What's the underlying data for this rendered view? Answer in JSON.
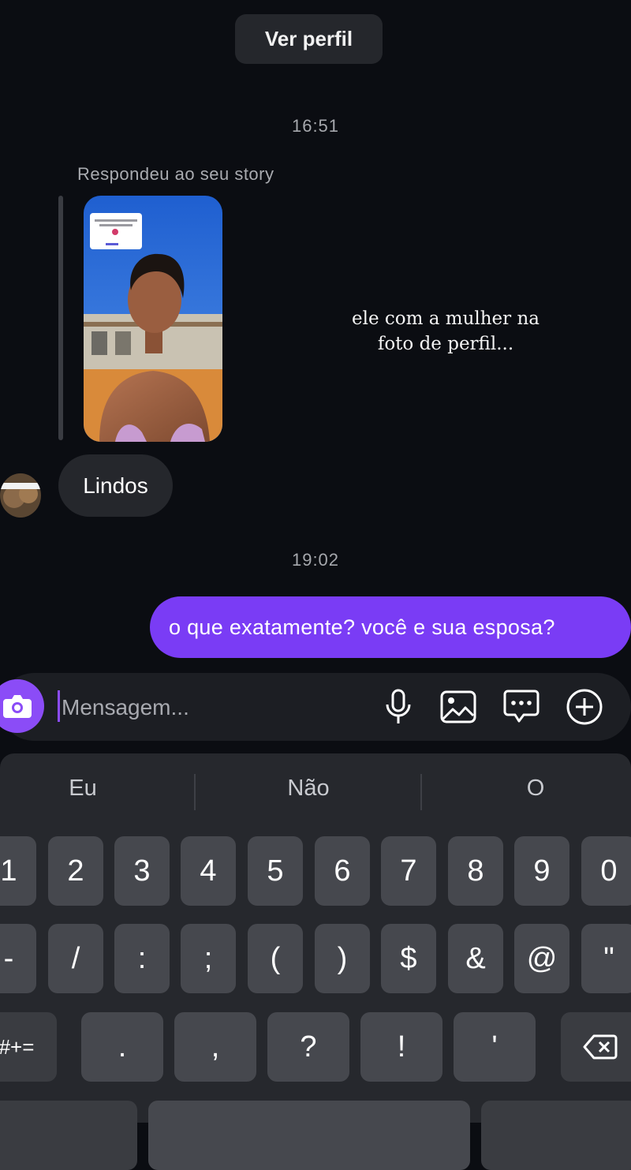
{
  "header": {
    "view_profile_label": "Ver perfil"
  },
  "timestamps": [
    "16:51",
    "19:02"
  ],
  "story_reply": {
    "caption": "Respondeu ao seu story",
    "overlay_text_line1": "ele com a mulher na",
    "overlay_text_line2": "foto de perfil...",
    "sticker_line1": "você em agosto de",
    "sticker_line2": "ano passado",
    "sticker_footer": "Sua vez"
  },
  "messages": {
    "incoming_text": "Lindos",
    "outgoing_text": "o que exatamente? você e sua esposa?"
  },
  "composer": {
    "placeholder": "Mensagem...",
    "icons": [
      "camera-icon",
      "microphone-icon",
      "gallery-icon",
      "sticker-message-icon",
      "plus-circle-icon"
    ],
    "accent_color": "#8b4cf7"
  },
  "keyboard": {
    "suggestions": [
      "Eu",
      "Não",
      "O"
    ],
    "row1": [
      "1",
      "2",
      "3",
      "4",
      "5",
      "6",
      "7",
      "8",
      "9",
      "0"
    ],
    "row2": [
      "-",
      "/",
      ":",
      ";",
      "(",
      ")",
      "$",
      "&",
      "@",
      "\""
    ],
    "row3_left": "#+=",
    "row3": [
      ".",
      ",",
      "?",
      "!",
      "'"
    ],
    "backspace_icon": "backspace-icon"
  },
  "colors": {
    "background": "#0b0d12",
    "outgoing_bubble": "#7a3cf5",
    "incoming_bubble": "#25272c"
  }
}
